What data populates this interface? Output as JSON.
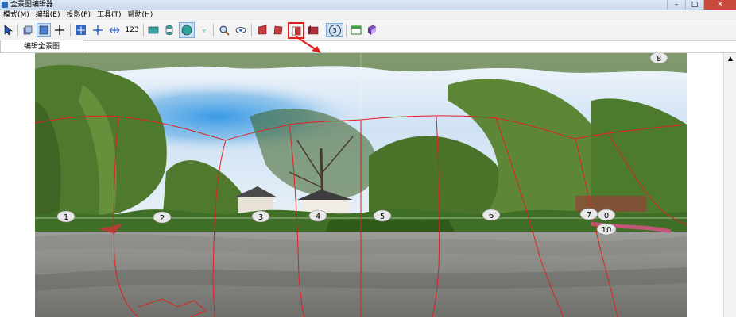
{
  "window": {
    "title": "全景图编辑器",
    "controls": {
      "minimize": "–",
      "maximize": "□",
      "close": "✕"
    }
  },
  "menu": [
    "模式(M)",
    "编辑(E)",
    "投影(P)",
    "工具(T)",
    "帮助(H)"
  ],
  "toolbar": {
    "number_button": "123",
    "circled_3": "3"
  },
  "tabs": {
    "active": "编辑全景图"
  },
  "hotspots": [
    "1",
    "2",
    "3",
    "4",
    "5",
    "6",
    "7",
    "0",
    "10",
    "8"
  ],
  "colors": {
    "highlight": "#e02020",
    "seams": "#e02020"
  }
}
